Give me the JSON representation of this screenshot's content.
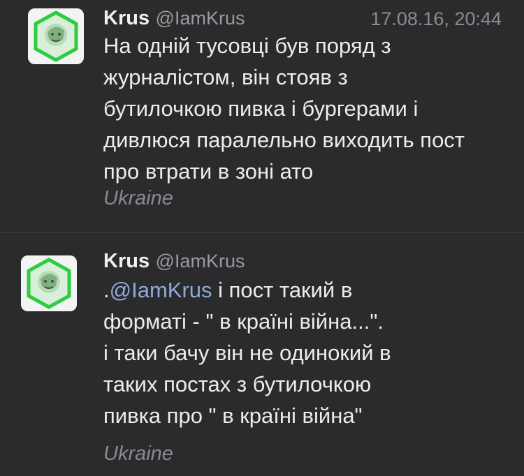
{
  "tweets": [
    {
      "author_name": "Krus",
      "author_handle": "@IamKrus",
      "timestamp": "17.08.16, 20:44",
      "lines": [
        "На одній тусовці був поряд з",
        "журналістом, він стояв з",
        "бутилочкою пивка і бургерами і",
        "дивлюся паралельно виходить пост",
        "про втрати в зоні ато"
      ],
      "location": "Ukraine"
    },
    {
      "author_name": "Krus",
      "author_handle": "@IamKrus",
      "mention_prefix": ".",
      "mention": "@IamKrus",
      "lines": [
        " і пост такий в",
        "форматі - \" в країні війна...\".",
        "і таки бачу він не одинокий в",
        "таких постах з бутилочкою",
        "пивка про \" в країні війна\""
      ],
      "location": "Ukraine"
    }
  ],
  "colors": {
    "background": "#2b2b2d",
    "mention": "#8fa9d8",
    "avatar_frame": "#2ecc40"
  }
}
